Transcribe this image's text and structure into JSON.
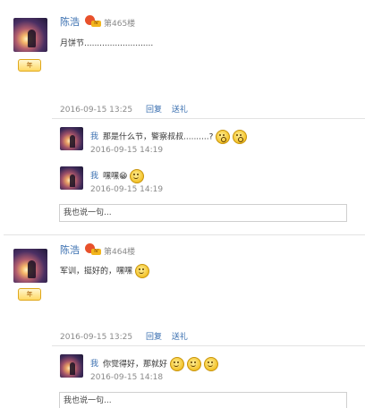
{
  "posts": [
    {
      "author": "陈浩",
      "medal_text": "Ⅳ",
      "floor": "第465楼",
      "level_badge": "年",
      "content": "月饼节...........................",
      "timestamp": "2016-09-15 13:25",
      "reply_label": "回复",
      "gift_label": "送礼",
      "replies": [
        {
          "user": "我",
          "text": "那是什么节，警察叔叔..........?",
          "time": "2016-09-15 14:19"
        },
        {
          "user": "我",
          "text": "嘿嘿😁",
          "time": "2016-09-15 14:19"
        }
      ],
      "reply_placeholder": "我也说一句..."
    },
    {
      "author": "陈浩",
      "medal_text": "Ⅳ",
      "floor": "第464楼",
      "level_badge": "年",
      "content": "军训，挺好的，嘿嘿",
      "timestamp": "2016-09-15 13:25",
      "reply_label": "回复",
      "gift_label": "送礼",
      "replies": [
        {
          "user": "我",
          "text": "你觉得好，那就好",
          "time": "2016-09-15 14:18"
        }
      ],
      "reply_placeholder": "我也说一句..."
    }
  ],
  "icons": {
    "medal": "medal-icon",
    "smiley": "smiley-icon",
    "shocked": "shocked-face-icon",
    "thinking": "thinking-face-icon"
  },
  "colors": {
    "link": "#3a6fb0",
    "muted": "#8a8a8a",
    "separator": "#e3e3e3"
  }
}
